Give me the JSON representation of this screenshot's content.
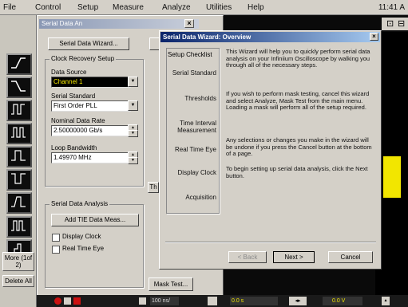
{
  "menubar": {
    "items": [
      "File",
      "Control",
      "Setup",
      "Measure",
      "Analyze",
      "Utilities",
      "Help"
    ],
    "clock": "11:41 A"
  },
  "sidebar": {
    "more_label": "More (1of 2)",
    "delete_label": "Delete All"
  },
  "sda": {
    "title": "Serial Data An",
    "wizard_button": "Serial Data Wizard...",
    "clock_recovery_group": "Clock Recovery Setup",
    "data_source_label": "Data Source",
    "data_source_value": "Channel 1",
    "serial_standard_label": "Serial Standard",
    "serial_standard_value": "First Order PLL",
    "nominal_rate_label": "Nominal Data Rate",
    "nominal_rate_value": "2.50000000 Gb/s",
    "loop_bw_label": "Loop Bandwidth",
    "loop_bw_value": "1.49970 MHz",
    "analysis_group": "Serial Data Analysis",
    "add_tie_button": "Add TIE Data Meas...",
    "display_clock_label": "Display Clock",
    "real_time_eye_label": "Real Time Eye",
    "mask_test_button": "Mask Test...",
    "partial_th": "Th"
  },
  "wizard": {
    "title": "Serial Data Wizard: Overview",
    "checklist_title": "Setup Checklist",
    "checklist": [
      "Serial Standard",
      "Thresholds",
      "Time Interval Measurement",
      "Real Time Eye",
      "Display Clock",
      "Acquisition"
    ],
    "para1": "This Wizard will help you to quickly perform serial data analysis on your Infiniium Oscilloscope by walking you through all of the necessary steps.",
    "para2": "If you wish to perform mask testing, cancel this wizard and select Analyze, Mask Test from the main menu. Loading a mask will perform all of the setup required.",
    "para3": "Any selections or changes you make in the wizard will be undone if you press the Cancel button at the bottom of a page.",
    "para4": "To begin setting up serial data analysis, click the Next button.",
    "back_button": "< Back",
    "next_button": "Next >",
    "cancel_button": "Cancel"
  },
  "status": {
    "horiz": "100 ns/",
    "trig": "0.0 s",
    "volt": "0.0 V"
  },
  "colors": {
    "wizard_title": "#0a246a",
    "waveform": "#f2e600",
    "panel": "#d4d0c8"
  }
}
